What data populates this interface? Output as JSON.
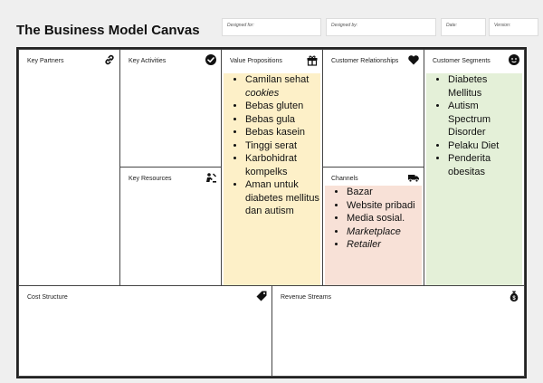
{
  "title": "The Business Model Canvas",
  "meta": {
    "designed_for": "Designed for:",
    "designed_by": "Designed by:",
    "date": "Date:",
    "version": "Version:"
  },
  "blocks": {
    "key_partners": "Key Partners",
    "key_activities": "Key Activities",
    "key_resources": "Key Resources",
    "value_propositions": "Value Propositions",
    "customer_relationships": "Customer Relationships",
    "channels": "Channels",
    "customer_segments": "Customer Segments",
    "cost_structure": "Cost Structure",
    "revenue_streams": "Revenue Streams"
  },
  "icons": {
    "key_partners": "link-icon",
    "key_activities": "check-circle-icon",
    "key_resources": "worker-icon",
    "value_propositions": "gift-icon",
    "customer_relationships": "heart-icon",
    "channels": "truck-icon",
    "customer_segments": "face-icon",
    "cost_structure": "price-tag-icon",
    "revenue_streams": "money-bag-icon"
  },
  "notes": {
    "value_propositions": {
      "color": "#fdf0c8",
      "items": [
        {
          "pre": "Camilan sehat ",
          "em": "cookies"
        },
        "Bebas gluten",
        "Bebas gula",
        "Bebas kasein",
        "Tinggi serat",
        "Karbohidrat kompelks",
        "Aman untuk diabetes mellitus dan autism"
      ]
    },
    "channels": {
      "color": "#f8e1d7",
      "items": [
        "Bazar",
        "Website pribadi",
        "Media sosial.",
        "Marketplace",
        "Retailer"
      ]
    },
    "customer_segments": {
      "color": "#e4f0d8",
      "items": [
        "Diabetes Mellitus",
        "Autism Spectrum Disorder",
        "Pelaku Diet",
        "Penderita obesitas"
      ]
    }
  }
}
